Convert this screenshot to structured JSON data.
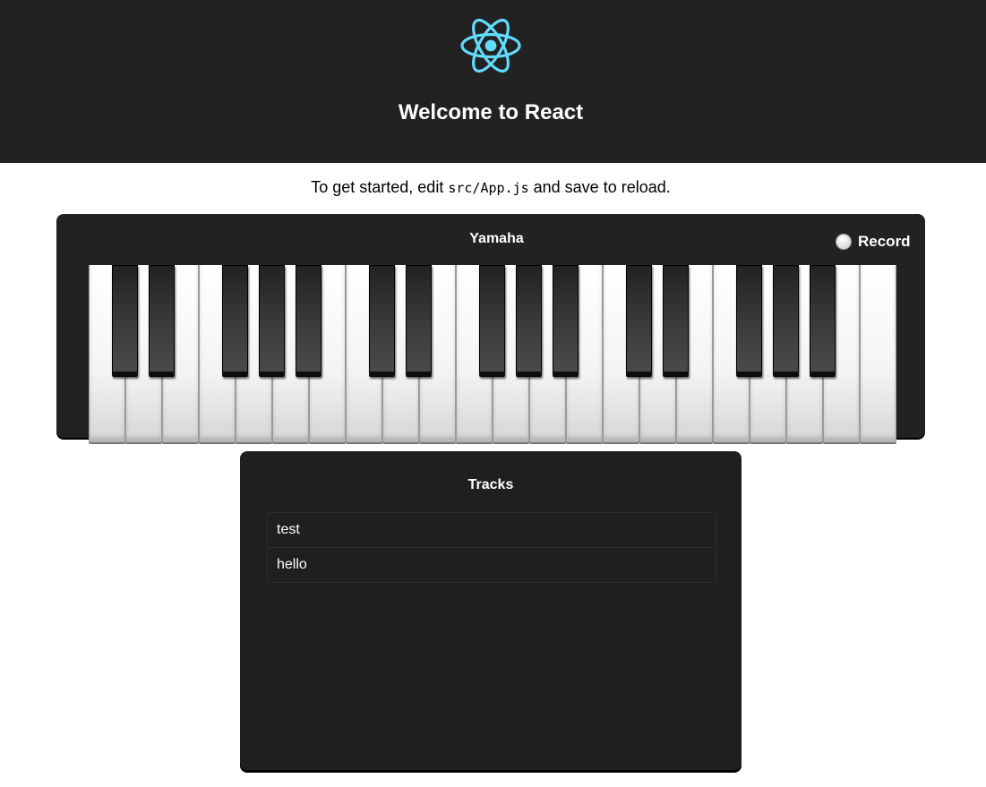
{
  "header": {
    "logo_icon": "react-atom-icon",
    "logo_color": "#61dafb",
    "title": "Welcome to React"
  },
  "intro": {
    "prefix": "To get started, edit ",
    "code": "src/App.js",
    "suffix": " and save to reload."
  },
  "piano": {
    "title": "Yamaha",
    "record_label": "Record",
    "record_icon": "record-dot-icon",
    "white_key_count": 22,
    "black_key_count": 15
  },
  "tracks": {
    "title": "Tracks",
    "items": [
      {
        "label": "test"
      },
      {
        "label": "hello"
      }
    ]
  }
}
